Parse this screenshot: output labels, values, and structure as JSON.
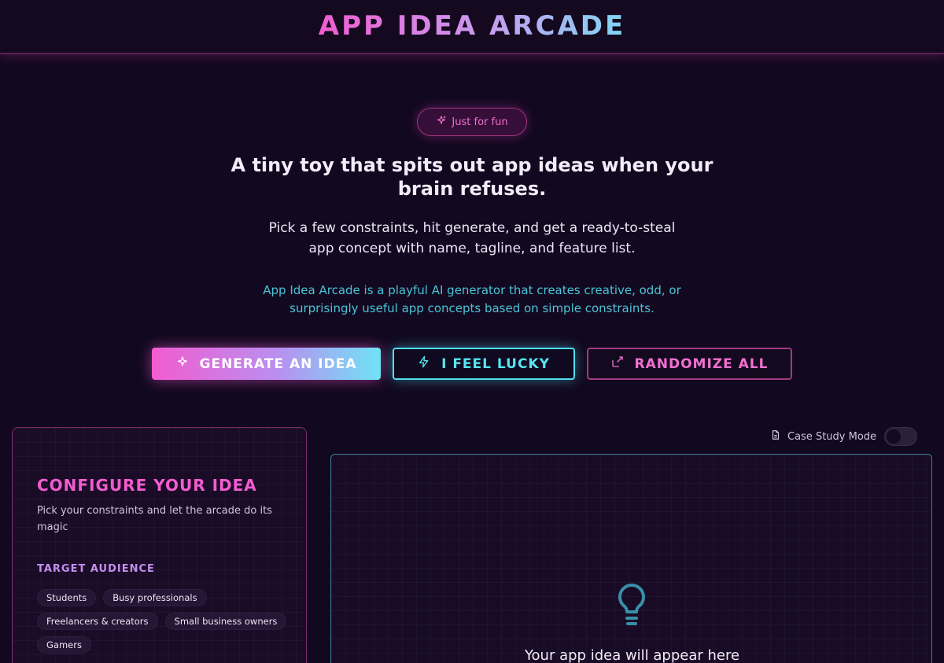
{
  "header": {
    "title": "APP IDEA ARCADE"
  },
  "hero": {
    "badge": "Just for fun",
    "headline": "A tiny toy that spits out app ideas when your brain refuses.",
    "subtext": "Pick a few constraints, hit generate, and get a ready-to-steal app concept with name, tagline, and feature list.",
    "description": "App Idea Arcade is a playful AI generator that creates creative, odd, or surprisingly useful app concepts based on simple constraints."
  },
  "actions": {
    "generate_label": "GENERATE AN IDEA",
    "lucky_label": "I FEEL LUCKY",
    "randomize_label": "RANDOMIZE ALL"
  },
  "config": {
    "title": "CONFIGURE YOUR IDEA",
    "subtitle": "Pick your constraints and let the arcade do its magic",
    "audience_label": "TARGET AUDIENCE",
    "audience_options": [
      "Students",
      "Busy professionals",
      "Freelancers & creators",
      "Small business owners",
      "Gamers"
    ]
  },
  "case_study": {
    "label": "Case Study Mode",
    "enabled": false
  },
  "output": {
    "placeholder": "Your app idea will appear here"
  },
  "colors": {
    "background": "#120820",
    "accent_pink": "#f25cd0",
    "accent_cyan": "#4fe0ee",
    "accent_purple": "#c38ff0"
  },
  "icons": {
    "badge": "sparkles-icon",
    "generate": "sparkles-icon",
    "lucky": "lightning-icon",
    "randomize": "shuffle-icon",
    "case_study": "document-icon",
    "placeholder": "lightbulb-icon"
  }
}
